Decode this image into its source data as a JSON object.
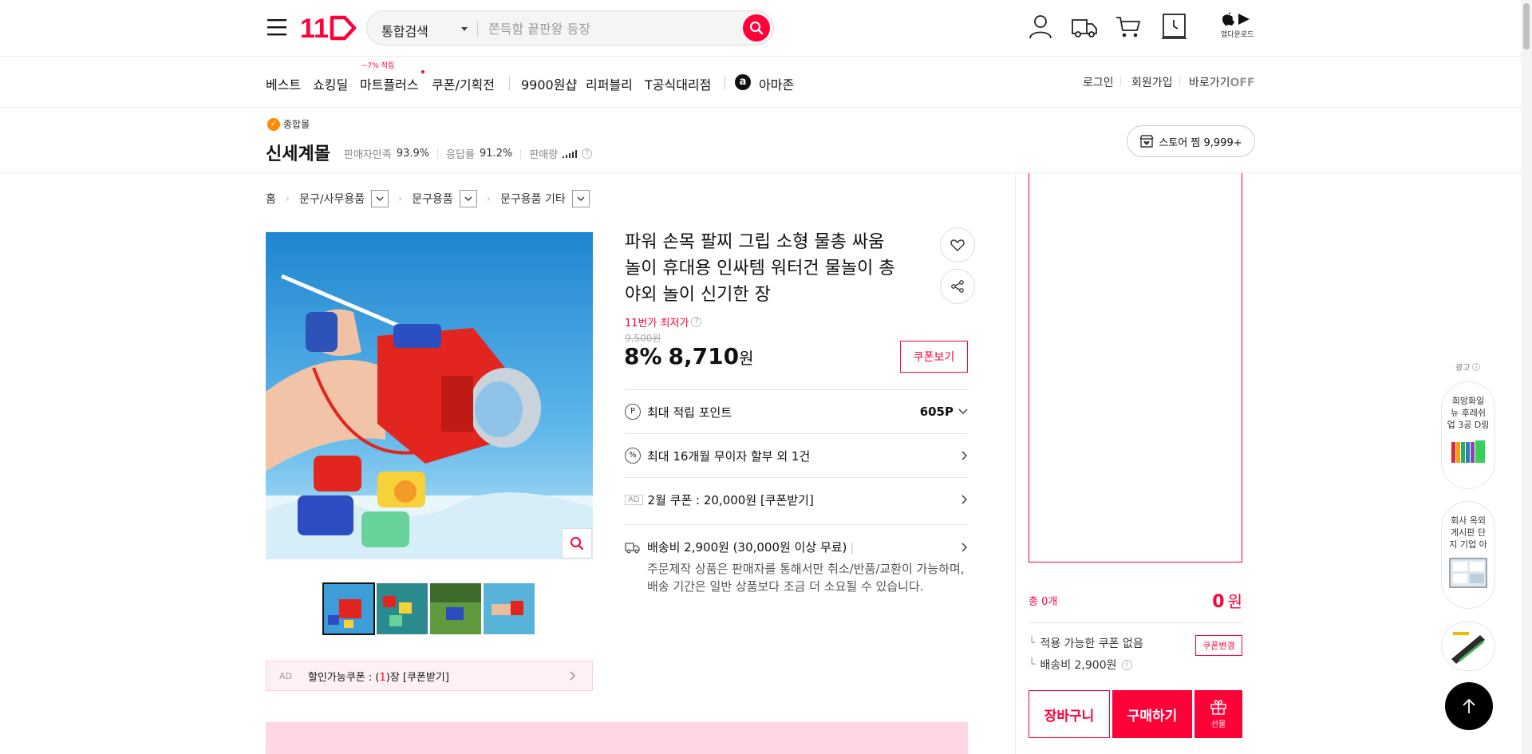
{
  "header": {
    "logo_text": "11",
    "search_category": "통합검색",
    "search_placeholder": "쫀득함 끝판왕 등장",
    "app_download": "앱다운로드"
  },
  "nav": {
    "items": [
      "베스트",
      "쇼킹딜",
      "마트플러스",
      "쿠폰/기획전",
      "9900원샵",
      "리퍼블리",
      "T공식대리점",
      "아마존"
    ],
    "mart_badge": "~7% 적립",
    "login": "로그인",
    "signup": "회원가입",
    "shortcut": "바로가기",
    "shortcut_state": "OFF"
  },
  "store": {
    "badge": "종합몰",
    "name": "신세계몰",
    "satisfaction_label": "판매자만족",
    "satisfaction": "93.9%",
    "response_label": "응답률",
    "response": "91.2%",
    "sales_label": "판매량",
    "follow": "스토어 찜 9,999+"
  },
  "breadcrumb": [
    "홈",
    "문구/사무용품",
    "문구용품",
    "문구용품 기타"
  ],
  "product": {
    "title": "파워 손목 팔찌 그립 소형 물총 싸움 놀이 휴대용 인싸템 워터건 물놀이 총 야외 놀이 신기한 장",
    "lowest_label": "11번가 최저가",
    "original_price": "9,500원",
    "discount": "8%",
    "price": "8,710",
    "currency": "원",
    "coupon_view": "쿠폰보기",
    "point_label": "최대 적립 포인트",
    "point_value": "605P",
    "installment": "최대 16개월 무이자 할부 외 1건",
    "ad_tag": "AD",
    "feb_coupon": "2월 쿠폰 : 20,000원 [쿠폰받기]",
    "shipping": "배송비 2,900원 (30,000원 이상 무료)",
    "shipping_note": "주문제작 상품은 판매자를 통해서만 취소/반품/교환이 가능하며, 배송 기간은 일반 상품보다 조금 더 소요될 수 있습니다.",
    "coupon_bar_ad": "AD",
    "coupon_bar_prefix": "할인가능쿠폰 : (",
    "coupon_bar_count": "1",
    "coupon_bar_suffix": ")장 [쿠폰받기]"
  },
  "order": {
    "total_label": "총 0개",
    "total_amount": "0",
    "total_currency": "원",
    "no_coupon": "적용 가능한 쿠폰 없음",
    "coupon_change": "쿠폰변경",
    "shipping": "배송비 2,900원",
    "cart": "장바구니",
    "buy": "구매하기",
    "gift": "선물"
  },
  "ads": {
    "label": "광고",
    "card1": "희망화일 뉴 후레쉬 업 3공 D링",
    "card2": "회사 옥외 게시판 단지 기업 아"
  },
  "colors": {
    "brand": "#ff0038",
    "pink_bg": "#fff0f3"
  }
}
